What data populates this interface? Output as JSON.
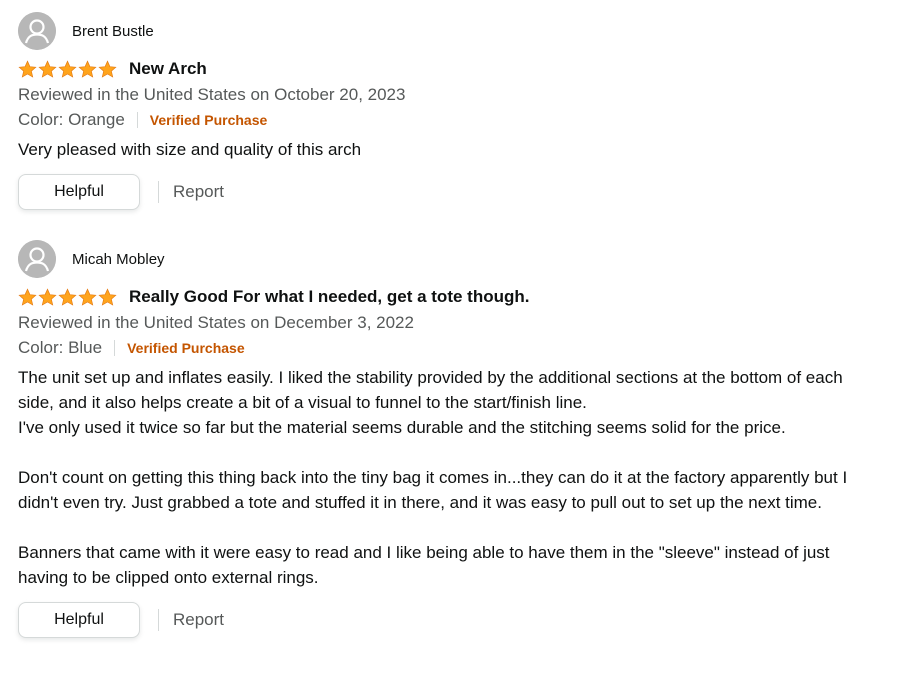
{
  "colors": {
    "star": "#ffa41c",
    "verified": "#c45500",
    "secondary_text": "#565959",
    "avatar": "#b7b7b7"
  },
  "reviews": [
    {
      "author": "Brent Bustle",
      "rating": 5,
      "title": "New Arch",
      "date": "Reviewed in the United States on October 20, 2023",
      "color": "Color: Orange",
      "verified": "Verified Purchase",
      "body": [
        "Very pleased with size and quality of this arch"
      ],
      "helpful_label": "Helpful",
      "report_label": "Report"
    },
    {
      "author": "Micah Mobley",
      "rating": 5,
      "title": "Really Good For what I needed, get a tote though.",
      "date": "Reviewed in the United States on December 3, 2022",
      "color": "Color: Blue",
      "verified": "Verified Purchase",
      "body": [
        "The unit set up and inflates easily. I liked the stability provided by the additional sections at the bottom of each side, and it also helps create a bit of a visual to funnel to the start/finish line.",
        "I've only used it twice so far but the material seems durable and the stitching seems solid for the price.",
        "Don't count on getting this thing back into the tiny bag it comes in...they can do it at the factory apparently but I didn't even try. Just grabbed a tote and stuffed it in there, and it was easy to pull out to set up the next time.",
        "Banners that came with it were easy to read and I like being able to have them in the \"sleeve\" instead of just having to be clipped onto external rings."
      ],
      "helpful_label": "Helpful",
      "report_label": "Report"
    }
  ]
}
